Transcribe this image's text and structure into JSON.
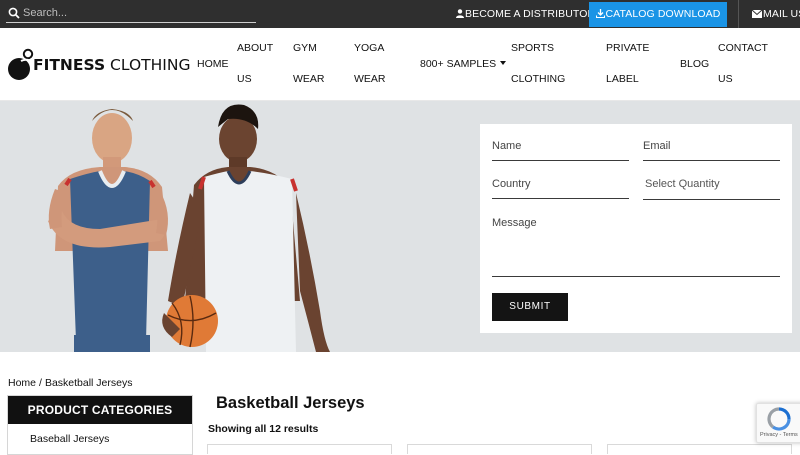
{
  "topbar": {
    "search_placeholder": "Search...",
    "distributor_label": "BECOME A DISTRIBUTOR",
    "catalog_label": "CATALOG DOWNLOAD",
    "mail_label": "MAIL US"
  },
  "logo": {
    "bold": "FITNESS",
    "regular": " CLOTHING"
  },
  "nav": {
    "home": "HOME",
    "about_1": "ABOUT",
    "about_2": "US",
    "gym_1": "GYM",
    "gym_2": "WEAR",
    "yoga_1": "YOGA",
    "yoga_2": "WEAR",
    "samples": "800+ SAMPLES",
    "sports_1": "SPORTS",
    "sports_2": "CLOTHING",
    "private_1": "PRIVATE",
    "private_2": "LABEL",
    "blog": "BLOG",
    "contact_1": "CONTACT",
    "contact_2": "US"
  },
  "form": {
    "name_placeholder": "Name",
    "email_placeholder": "Email",
    "country_placeholder": "Country",
    "quantity_placeholder": "Select Quantity",
    "message_placeholder": "Message",
    "submit_label": "SUBMIT"
  },
  "breadcrumb": {
    "home": "Home",
    "separator": "/",
    "current": "Basketball Jerseys"
  },
  "sidebar": {
    "heading": "PRODUCT CATEGORIES",
    "first_item": "Baseball Jerseys"
  },
  "main": {
    "title": "Basketball Jerseys",
    "result_count": "Showing all 12 results"
  },
  "recaptcha": {
    "footer": "Privacy - Terms"
  },
  "colors": {
    "topbar": "#2f2f2f",
    "accent": "#1a94e6",
    "dark": "#141414",
    "hero_bg": "#dfe2e4"
  }
}
